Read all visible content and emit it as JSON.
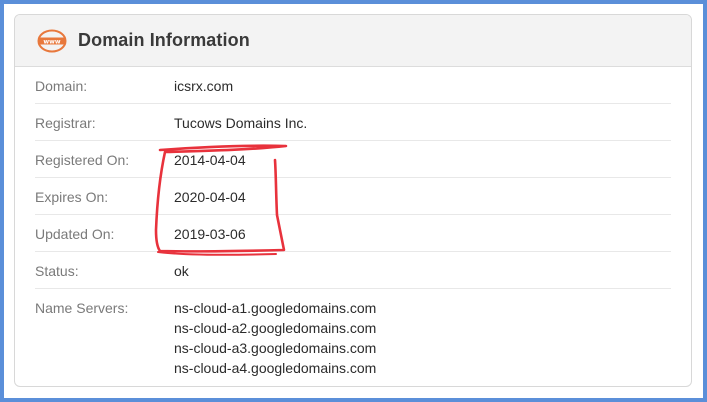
{
  "card": {
    "title": "Domain Information",
    "icon": "www-icon",
    "accent_color": "#e8783c"
  },
  "rows": [
    {
      "label": "Domain:",
      "value": "icsrx.com"
    },
    {
      "label": "Registrar:",
      "value": "Tucows Domains Inc."
    },
    {
      "label": "Registered On:",
      "value": "2014-04-04"
    },
    {
      "label": "Expires On:",
      "value": "2020-04-04"
    },
    {
      "label": "Updated On:",
      "value": "2019-03-06"
    },
    {
      "label": "Status:",
      "value": "ok"
    }
  ],
  "name_servers": {
    "label": "Name Servers:",
    "values": [
      "ns-cloud-a1.googledomains.com",
      "ns-cloud-a2.googledomains.com",
      "ns-cloud-a3.googledomains.com",
      "ns-cloud-a4.googledomains.com"
    ]
  },
  "annotation": {
    "shape": "hand-drawn-bracket",
    "color": "#e8323c"
  },
  "colors": {
    "frame_border": "#5b8fd9",
    "header_bg": "#f3f3f3",
    "label_text": "#7a7a7a",
    "value_text": "#2b2b2b"
  }
}
